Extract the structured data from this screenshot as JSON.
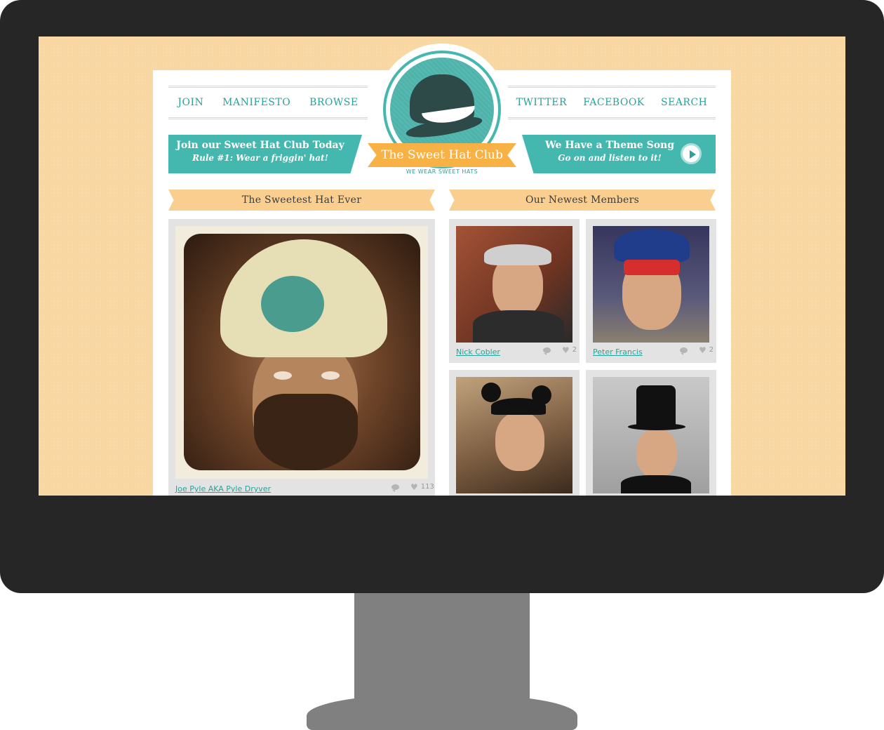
{
  "nav_left": [
    "JOIN",
    "MANIFESTO",
    "BROWSE"
  ],
  "nav_right": [
    "TWITTER",
    "FACEBOOK",
    "SEARCH"
  ],
  "logo": {
    "title": "The Sweet Hat Club",
    "tagline": "WE WEAR SWEET HATS"
  },
  "banner_join": {
    "title": "Join our Sweet Hat Club Today",
    "subtitle": "Rule #1: Wear a friggin' hat!"
  },
  "banner_song": {
    "title": "We Have a Theme Song",
    "subtitle": "Go on and listen to it!"
  },
  "sections": {
    "featured": "The Sweetest Hat Ever",
    "members": "Our Newest Members"
  },
  "featured": {
    "name": "Joe Pyle AKA Pyle Dryver",
    "likes": "113"
  },
  "members": [
    {
      "name": "Nick Cobler",
      "likes": "2"
    },
    {
      "name": "Peter Francis",
      "likes": "2"
    },
    {
      "name": "",
      "likes": ""
    },
    {
      "name": "",
      "likes": ""
    }
  ],
  "colors": {
    "teal": "#44b8ae",
    "orange": "#f7b144",
    "peach": "#f9ce8e",
    "screen_bg": "#f8d7a2",
    "hat": "#2e4a48"
  },
  "icons": [
    "comment-icon",
    "heart-icon",
    "play-icon",
    "bowler-hat-icon"
  ]
}
